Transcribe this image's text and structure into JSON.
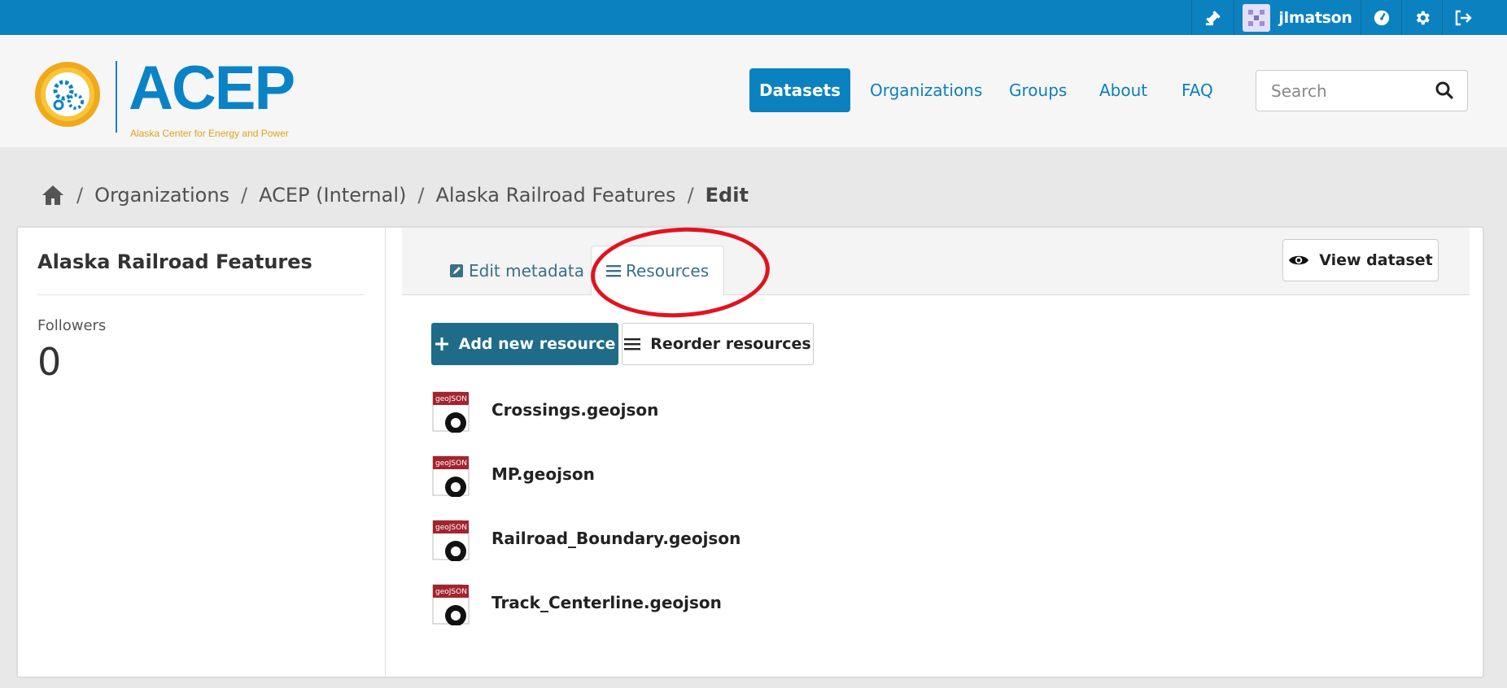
{
  "account": {
    "username": "jlmatson",
    "icons": [
      "gavel-icon",
      "avatar",
      "dashboard-icon",
      "gear-icon",
      "sign-out-icon"
    ]
  },
  "brand": {
    "name": "ACEP",
    "tagline": "Alaska Center for Energy and Power"
  },
  "nav": {
    "items": [
      "Datasets",
      "Organizations",
      "Groups",
      "About",
      "FAQ"
    ],
    "active": "Datasets"
  },
  "search": {
    "placeholder": "Search"
  },
  "breadcrumb": {
    "items": [
      "Organizations",
      "ACEP (Internal)",
      "Alaska Railroad Features",
      "Edit"
    ]
  },
  "sidebar": {
    "title": "Alaska Railroad Features",
    "followers_label": "Followers",
    "followers_count": "0"
  },
  "tabs": {
    "edit_metadata": "Edit metadata",
    "resources": "Resources",
    "view_dataset": "View dataset"
  },
  "actions": {
    "add_resource": "Add new resource",
    "reorder_resources": "Reorder resources"
  },
  "resources": [
    {
      "name": "Crossings.geojson",
      "format_label": "geoJSON"
    },
    {
      "name": "MP.geojson",
      "format_label": "geoJSON"
    },
    {
      "name": "Railroad_Boundary.geojson",
      "format_label": "geoJSON"
    },
    {
      "name": "Track_Centerline.geojson",
      "format_label": "geoJSON"
    }
  ],
  "colors": {
    "primary": "#0b82bf",
    "button_dark": "#1f6c88",
    "annotation": "#e0141e",
    "logo_gold": "#e0a21a"
  }
}
